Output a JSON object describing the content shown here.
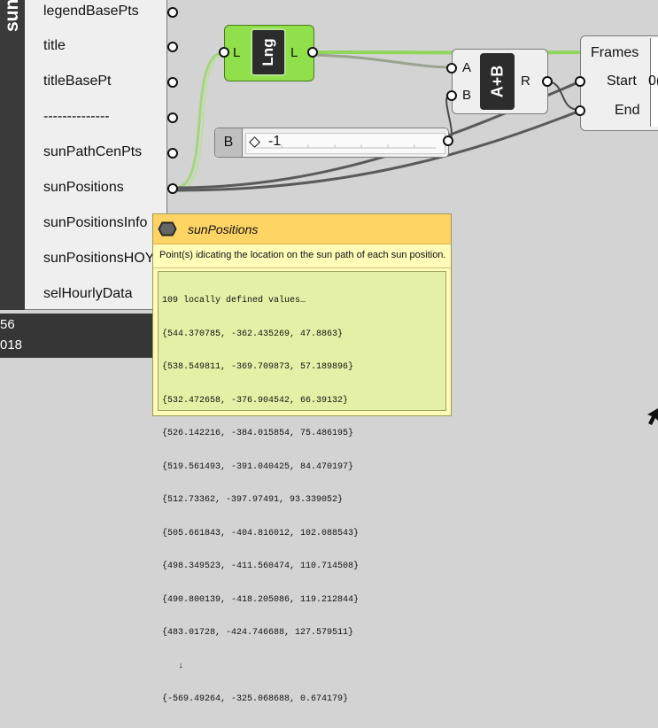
{
  "sun_component": {
    "name": "sun",
    "outputs": [
      {
        "label": "legendBasePts",
        "key": "legendBasePts"
      },
      {
        "label": "title",
        "key": "title"
      },
      {
        "label": "titleBasePt",
        "key": "titleBasePt"
      },
      {
        "label": "--------------",
        "key": "separator"
      },
      {
        "label": "sunPathCenPts",
        "key": "sunPathCenPts"
      },
      {
        "label": "sunPositions",
        "key": "sunPositions"
      },
      {
        "label": "sunPositionsInfo",
        "key": "sunPositionsInfo"
      },
      {
        "label": "sunPositionsHOY",
        "key": "sunPositionsHOY"
      },
      {
        "label": "selHourlyData",
        "key": "selHourlyData"
      }
    ],
    "side_values": [
      "56",
      "018"
    ]
  },
  "lng_component": {
    "input": "L",
    "output": "L",
    "icon_label": "Lng"
  },
  "add_component": {
    "inputs": [
      "A",
      "B"
    ],
    "output": "R",
    "icon_label": "A+B"
  },
  "frames_component": {
    "inputs": [
      "Frames",
      "Start",
      "End"
    ],
    "start_value_fragment": "0("
  },
  "slider": {
    "label": "B",
    "value": "-1"
  },
  "tooltip": {
    "title": "sunPositions",
    "description": "Point(s) idicating the location on the sun path of each sun position.",
    "values_header": "109 locally defined values…",
    "values": [
      "{544.370785, -362.435269, 47.8863}",
      "{538.549811, -369.709873, 57.189896}",
      "{532.472658, -376.904542, 66.39132}",
      "{526.142216, -384.015854, 75.486195}",
      "{519.561493, -391.040425, 84.470197}",
      "{512.73362, -397.97491, 93.339052}",
      "{505.661843, -404.816012, 102.088543}",
      "{498.349523, -411.560474, 110.714508}",
      "{490.800139, -418.205086, 119.212844}",
      "{483.01728, -424.746688, 127.579511}"
    ],
    "ellipsis": "↓",
    "last_value": "{-569.49264, -325.068688, 0.674179}"
  },
  "colors": {
    "canvas": "#d3d3d3",
    "component_fill": "#efefef",
    "lng_fill": "#8fe04b",
    "tooltip_header": "#fed465",
    "tooltip_body": "#fffcb8",
    "tooltip_values": "#e4f0a6",
    "wire_green": "#a6d57e",
    "wire_dark": "#5a5a5a"
  },
  "icons": {
    "tooltip_icon": "hexagon-point-param-icon",
    "corner_icon": "cursor-arrow-icon"
  }
}
